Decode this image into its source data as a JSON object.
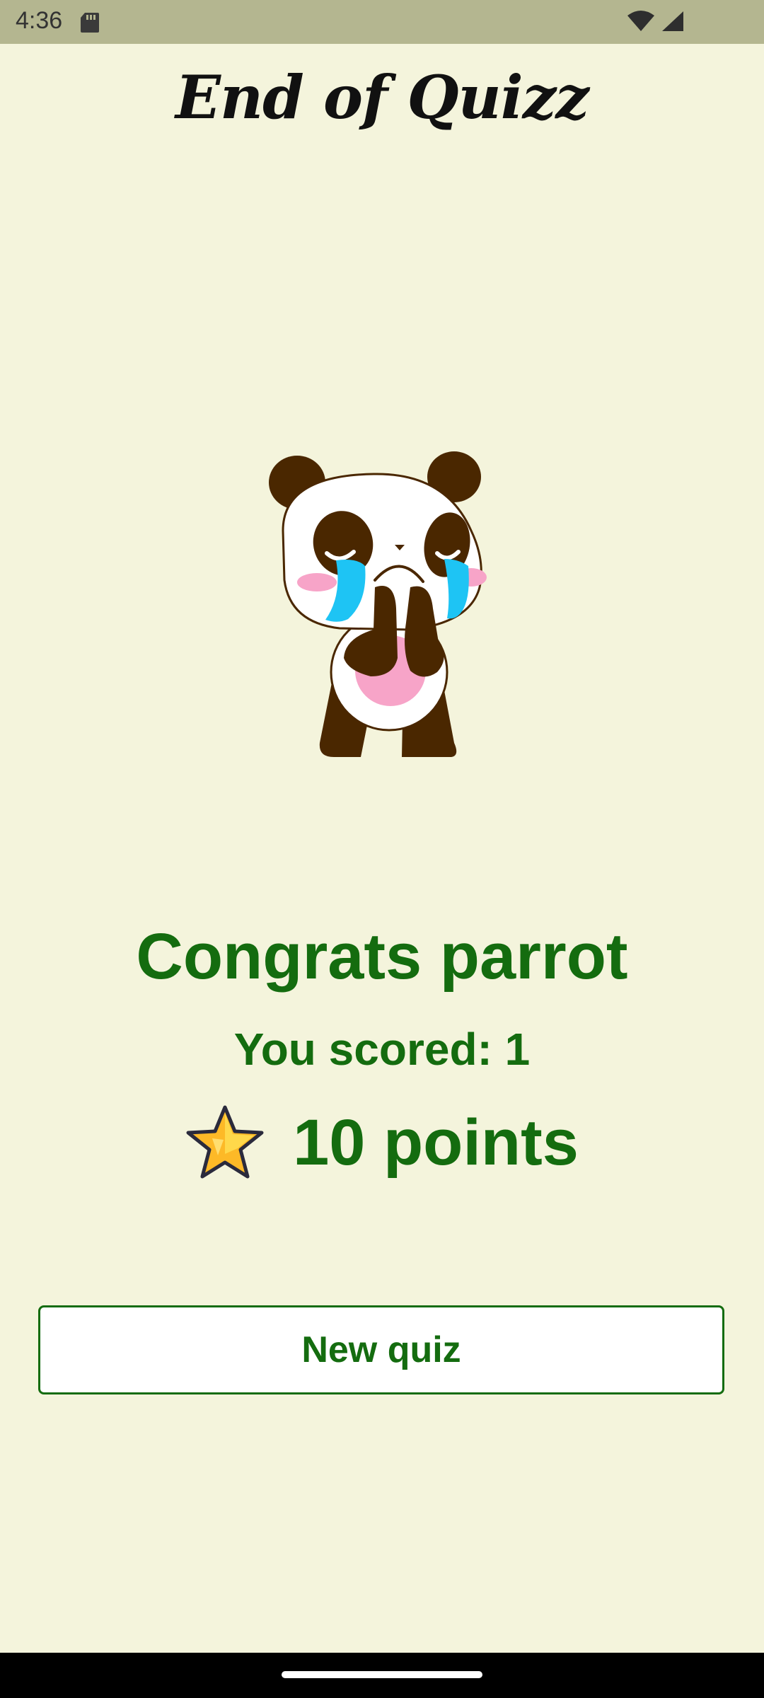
{
  "status_bar": {
    "time": "4:36",
    "icons": [
      "sd-card-icon",
      "wifi-icon",
      "signal-icon"
    ]
  },
  "title": "End of Quizz",
  "illustration": "crying-panda-illustration",
  "result": {
    "congrats": "Congrats parrot",
    "score": "You scored: 1",
    "points": "10 points",
    "points_icon": "star-icon"
  },
  "actions": {
    "new_quiz_label": "New quiz"
  },
  "colors": {
    "background": "#f4f4dc",
    "status_bar": "#b4b690",
    "accent_green": "#146c0f",
    "button_bg": "#ffffff"
  }
}
